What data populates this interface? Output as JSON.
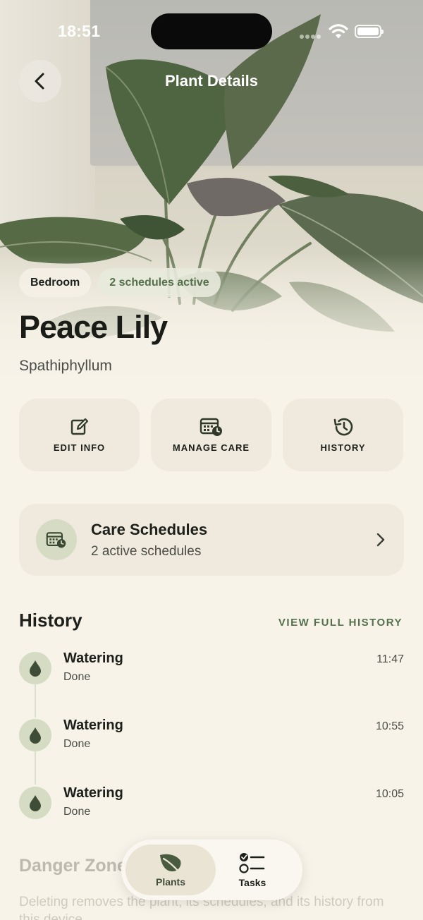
{
  "status_bar": {
    "time": "18:51"
  },
  "nav": {
    "title": "Plant Details"
  },
  "plant": {
    "location": "Bedroom",
    "schedules_badge": "2 schedules active",
    "name": "Peace Lily",
    "scientific_name": "Spathiphyllum"
  },
  "actions": [
    {
      "label": "EDIT INFO",
      "icon": "edit-icon"
    },
    {
      "label": "MANAGE CARE",
      "icon": "calendar-clock-icon"
    },
    {
      "label": "HISTORY",
      "icon": "history-icon"
    }
  ],
  "care_card": {
    "title": "Care Schedules",
    "subtitle": "2 active schedules"
  },
  "history": {
    "title": "History",
    "view_all": "VIEW FULL HISTORY",
    "items": [
      {
        "event": "Watering",
        "status": "Done",
        "time": "11:47"
      },
      {
        "event": "Watering",
        "status": "Done",
        "time": "10:55"
      },
      {
        "event": "Watering",
        "status": "Done",
        "time": "10:05"
      }
    ]
  },
  "danger": {
    "title": "Danger Zone",
    "description": "Deleting removes the plant, its schedules, and its history from this device."
  },
  "tabs": [
    {
      "label": "Plants",
      "icon": "leaf-icon",
      "active": true
    },
    {
      "label": "Tasks",
      "icon": "checklist-icon",
      "active": false
    }
  ],
  "colors": {
    "background": "#f7f3e9",
    "accent": "#55704c",
    "card": "#efeadd",
    "icon_circle": "#d6dcc4"
  }
}
